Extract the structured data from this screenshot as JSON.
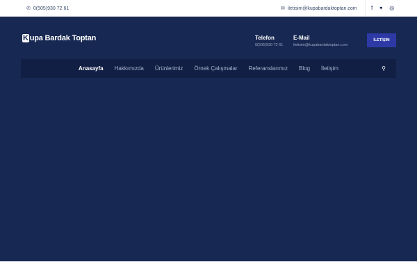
{
  "topbar": {
    "phone": "0(505)930 72 61",
    "email": "iletisim@kupabardaktoptan.com",
    "social": [
      {
        "icon": "facebook-icon",
        "glyph": "f"
      },
      {
        "icon": "twitter-icon",
        "glyph": "🐦"
      },
      {
        "icon": "instagram-icon",
        "glyph": "◎"
      }
    ]
  },
  "header": {
    "logo_letter": "K",
    "logo_rest": "upa Bardak Toptan",
    "phone_label": "Telefon",
    "phone_value": "0(505)930 72 61",
    "email_label": "E-Mail",
    "email_value": "iletisim@kupabardaktoptan.com",
    "cta": "İLETİŞİM"
  },
  "nav": {
    "items": [
      "Anasayfa",
      "Hakkımızda",
      "Ürünlerimiz",
      "Örnek Çalışmalar",
      "Referanslarımız",
      "Blog",
      "İletişim"
    ]
  },
  "colors": {
    "primary": "#172852",
    "nav": "#121f45",
    "button": "#2d3aa6"
  }
}
